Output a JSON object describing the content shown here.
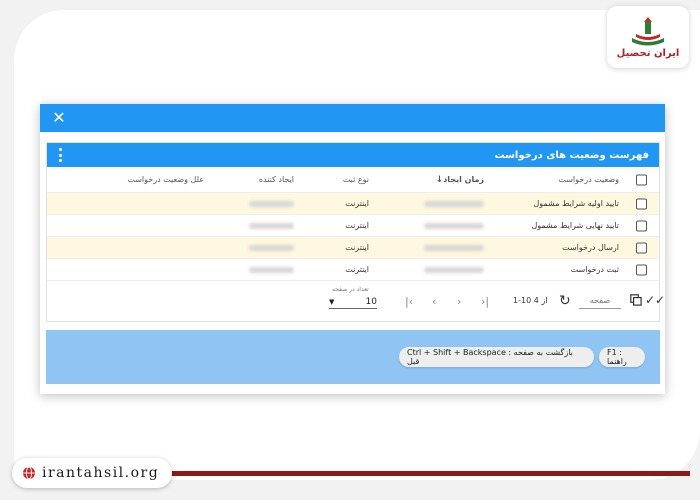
{
  "branding": {
    "logo_text": "ایران تحصیل",
    "site": "irantahsil.org"
  },
  "dialog": {
    "close_icon": "close-icon"
  },
  "panel": {
    "title": "فهرست وضعیت های درخواست",
    "menu_icon": "more-vertical-icon"
  },
  "table": {
    "columns": {
      "status": "وضعیت درخواست",
      "time": "زمان ایجاد",
      "type": "نوع ثبت",
      "creator": "ایجاد کننده",
      "reason": "علل وضعیت درخواست"
    },
    "rows": [
      {
        "status": "تایید اولیه شرایط مشمول",
        "type": "اینترنت"
      },
      {
        "status": "تایید نهایی شرایط مشمول",
        "type": "اینترنت"
      },
      {
        "status": "ارسال درخواست",
        "type": "اینترنت"
      },
      {
        "status": "ثبت درخواست",
        "type": "اینترنت"
      }
    ]
  },
  "pager": {
    "rows_per_page_label": "تعداد در صفحه",
    "rows_per_page_value": "10",
    "range": "1-10 از 4",
    "page_label": "صفحه"
  },
  "hints": {
    "back": "Ctrl + Shift + Backspace : بازگشت به صفحه قبل",
    "help": "F1 : راهنما"
  },
  "colors": {
    "primary": "#2196f3",
    "highlight_row": "#fdf8df",
    "hint_bar": "#90c5f3",
    "brand_red": "#8b1a1a"
  }
}
